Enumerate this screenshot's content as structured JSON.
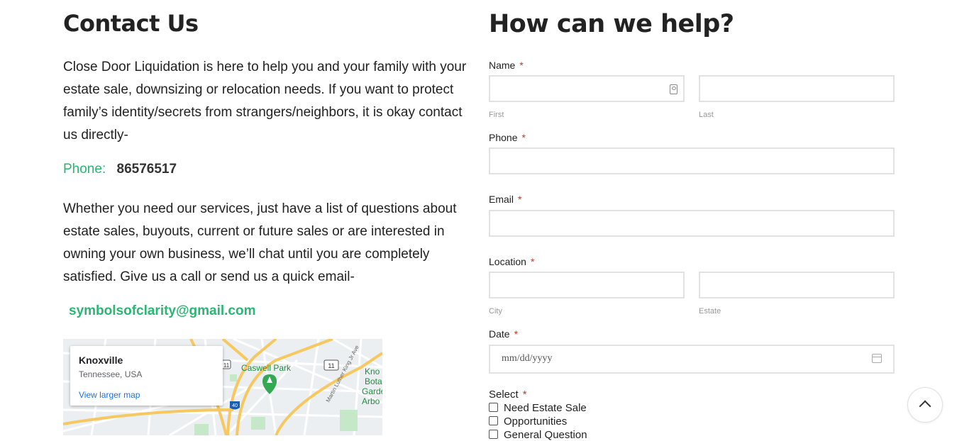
{
  "left": {
    "title": "Contact Us",
    "para1": "Close Door Liquidation is here to help you and your family with your estate sale, downsizing or relocation needs.  If you want to protect family’s identity/secrets from strangers/neighbors, it is okay contact us directly-",
    "phone_label": "Phone:",
    "phone_number": "86576517",
    "para2": "Whether you need our services, just have a list of questions about estate sales, buyouts, current or future sales or are interested in owning your own business, we’ll chat until you are completely satisfied.  Give us a call or send us a quick email-",
    "email": "symbolsofclarity@gmail.com"
  },
  "map": {
    "city": "Knoxville",
    "state": "Tennessee, USA",
    "link": "View larger map",
    "park": "Caswell Park",
    "edge_text": "Knoxville Botanical Garden & Arboretum",
    "street": "Martin Luther King Jr Ave",
    "route_11": "11",
    "route_40": "40"
  },
  "form": {
    "title": "How can we help?",
    "name_label": "Name",
    "required": "*",
    "first": "First",
    "last": "Last",
    "phone_label": "Phone",
    "email_label": "Email",
    "location_label": "Location",
    "city": "City",
    "estate": "Estate",
    "date_label": "Date",
    "date_placeholder": "mm/dd/yyyy",
    "select_label": "Select",
    "options": [
      "Need Estate Sale",
      "Opportunities",
      "General Question"
    ]
  },
  "colors": {
    "accent": "#2bb673",
    "required": "#c0392b",
    "link": "#1a73e8"
  },
  "icons": [
    "contact-card-icon",
    "calendar-icon",
    "chevron-up-icon",
    "park-pin-icon"
  ]
}
